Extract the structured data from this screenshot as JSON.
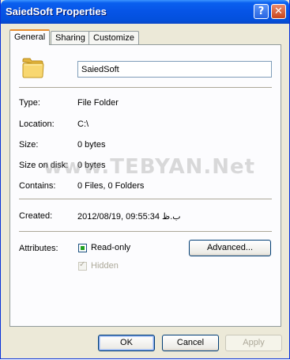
{
  "window": {
    "title": "SaiedSoft Properties"
  },
  "titlebar": {
    "help_glyph": "?",
    "close_glyph": "✕"
  },
  "tabs": [
    "General",
    "Sharing",
    "Customize"
  ],
  "name_field": {
    "value": "SaiedSoft",
    "icon": "folder-icon"
  },
  "info": {
    "type_label": "Type:",
    "type_value": "File Folder",
    "location_label": "Location:",
    "location_value": "C:\\",
    "size_label": "Size:",
    "size_value": "0 bytes",
    "size_on_disk_label": "Size on disk:",
    "size_on_disk_value": "0 bytes",
    "contains_label": "Contains:",
    "contains_value": "0 Files, 0 Folders",
    "created_label": "Created:",
    "created_value": "2012/08/19, 09:55:34 ب.ظ"
  },
  "attributes": {
    "label": "Attributes:",
    "readonly_label": "Read-only",
    "hidden_label": "Hidden",
    "advanced_button": "Advanced..."
  },
  "watermark": "www.TEBYAN.Net",
  "footer": {
    "ok": "OK",
    "cancel": "Cancel",
    "apply": "Apply"
  },
  "colors": {
    "title_blue": "#0654e6",
    "dialog_bg": "#ece9d8",
    "tab_accent": "#e68b2c"
  }
}
